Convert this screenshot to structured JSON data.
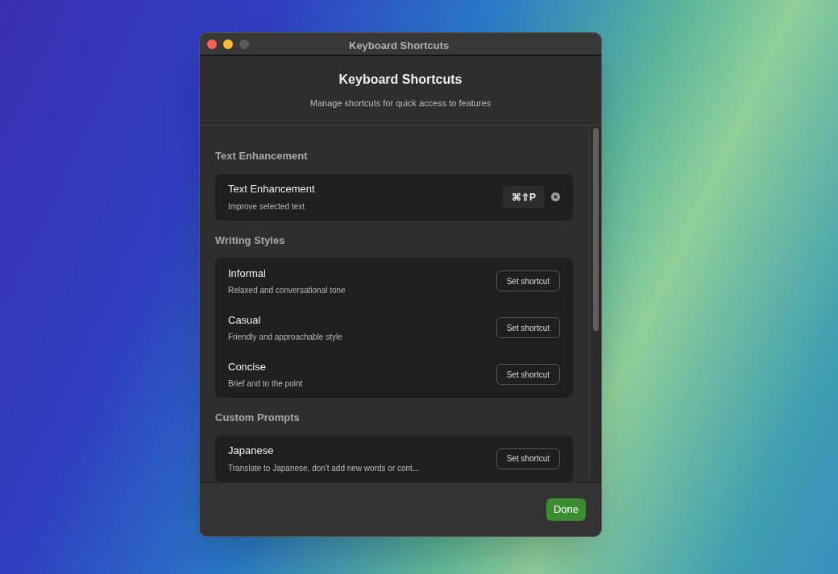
{
  "window": {
    "title": "Keyboard Shortcuts"
  },
  "header": {
    "title": "Keyboard Shortcuts",
    "subtitle": "Manage shortcuts for quick access to features"
  },
  "sections": [
    {
      "title": "Text Enhancement",
      "items": [
        {
          "kind": "recorded",
          "name": "Text Enhancement",
          "description": "Improve selected text",
          "shortcut": "⌘⇧P"
        }
      ]
    },
    {
      "title": "Writing Styles",
      "items": [
        {
          "kind": "unset",
          "name": "Informal",
          "description": "Relaxed and conversational tone",
          "button": "Set shortcut"
        },
        {
          "kind": "unset",
          "name": "Casual",
          "description": "Friendly and approachable style",
          "button": "Set shortcut"
        },
        {
          "kind": "unset",
          "name": "Concise",
          "description": "Brief and to the point",
          "button": "Set shortcut"
        }
      ]
    },
    {
      "title": "Custom Prompts",
      "items": [
        {
          "kind": "unset",
          "name": "Japanese",
          "description": "Translate to Japanese, don't add new words or cont...",
          "button": "Set shortcut"
        }
      ]
    }
  ],
  "footer": {
    "button": "Done"
  }
}
